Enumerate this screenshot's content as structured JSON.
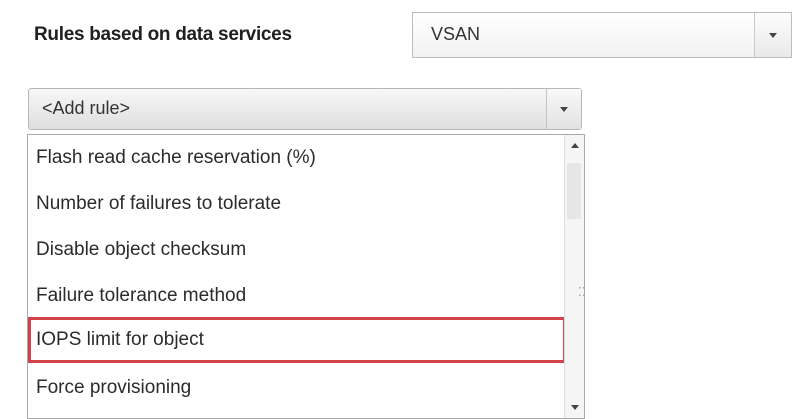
{
  "header": {
    "rules_label": "Rules based on data services",
    "data_service_select": {
      "value": "VSAN"
    }
  },
  "add_rule": {
    "value": "<Add rule>"
  },
  "dropdown": {
    "items": [
      {
        "label": "Flash read cache reservation (%)",
        "highlighted": false
      },
      {
        "label": "Number of failures to tolerate",
        "highlighted": false
      },
      {
        "label": "Disable object checksum",
        "highlighted": false
      },
      {
        "label": "Failure tolerance method",
        "highlighted": false
      },
      {
        "label": "IOPS limit for object",
        "highlighted": true
      },
      {
        "label": "Force provisioning",
        "highlighted": false
      }
    ],
    "highlight_color": "#d2434a"
  },
  "icons": {
    "select_arrow": "chevron-down-icon",
    "scroll_up": "scroll-up-arrow-icon",
    "scroll_down": "scroll-down-arrow-icon",
    "resize_grip": "resize-grip-icon",
    "grip_glyph": "⁚⁚"
  }
}
